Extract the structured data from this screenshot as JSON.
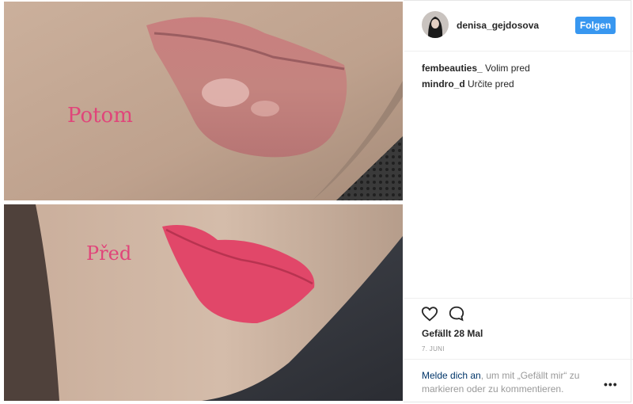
{
  "photo": {
    "top_label": "Potom",
    "bottom_label": "Před"
  },
  "post": {
    "username": "denisa_gejdosova",
    "follow_label": "Folgen",
    "comments": [
      {
        "user": "fembeauties_",
        "text": "Volim pred"
      },
      {
        "user": "mindro_d",
        "text": "Určite pred"
      }
    ],
    "likes": "Gefällt 28 Mal",
    "date": "7. JUNI",
    "login_link": "Melde dich an",
    "login_text": ", um mit „Gefällt mir“ zu markieren oder zu kommentieren.",
    "more_label": "•••"
  },
  "icons": {
    "like": "heart-icon",
    "comment": "speech-bubble-icon",
    "more": "more-options-icon"
  },
  "colors": {
    "accent": "#3897f0",
    "label_pink": "#e0457a",
    "lip_pink": "#e14769"
  }
}
